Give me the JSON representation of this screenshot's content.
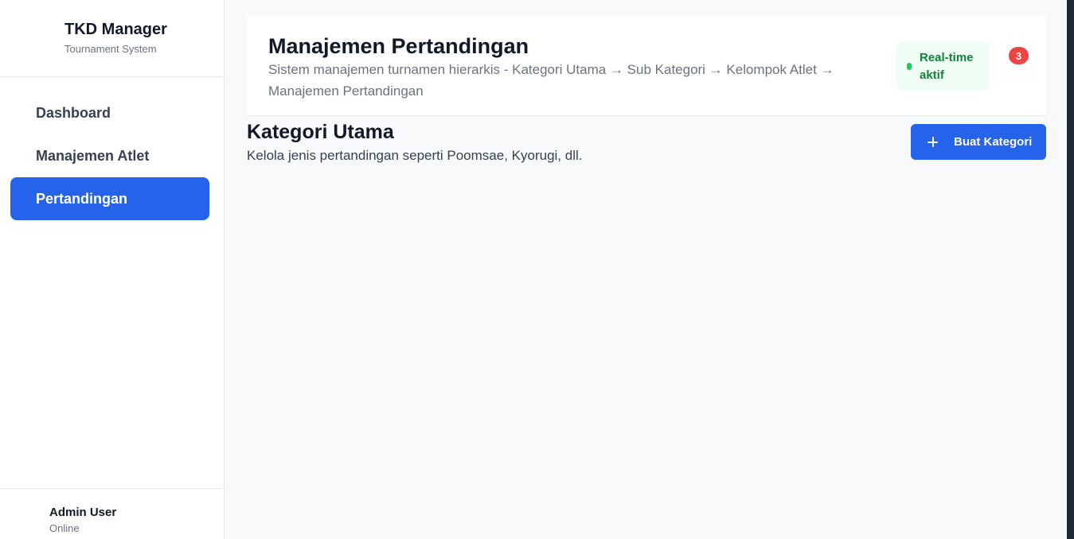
{
  "sidebar": {
    "brand": {
      "title": "TKD Manager",
      "subtitle": "Tournament System"
    },
    "items": [
      {
        "label": "Dashboard",
        "active": false
      },
      {
        "label": "Manajemen Atlet",
        "active": false
      },
      {
        "label": "Pertandingan",
        "active": true
      }
    ],
    "user": {
      "name": "Admin User",
      "status": "Online"
    }
  },
  "header": {
    "title": "Manajemen Pertandingan",
    "description": "Sistem manajemen turnamen hierarkis - Kategori Utama → Sub Kategori → Kelompok Atlet → Manajemen Pertandingan",
    "realtime_label": "Real-time aktif",
    "notification_count": "3"
  },
  "section": {
    "title": "Kategori Utama",
    "description": "Kelola jenis pertandingan seperti Poomsae, Kyorugi, dll.",
    "create_button_label": "Buat Kategori",
    "create_button_icon": "plus-icon"
  },
  "colors": {
    "accent": "#2563eb",
    "realtime_bg": "#f0fdf4",
    "realtime_text": "#15803d",
    "realtime_dot": "#22c55e",
    "notification": "#ef4444"
  }
}
